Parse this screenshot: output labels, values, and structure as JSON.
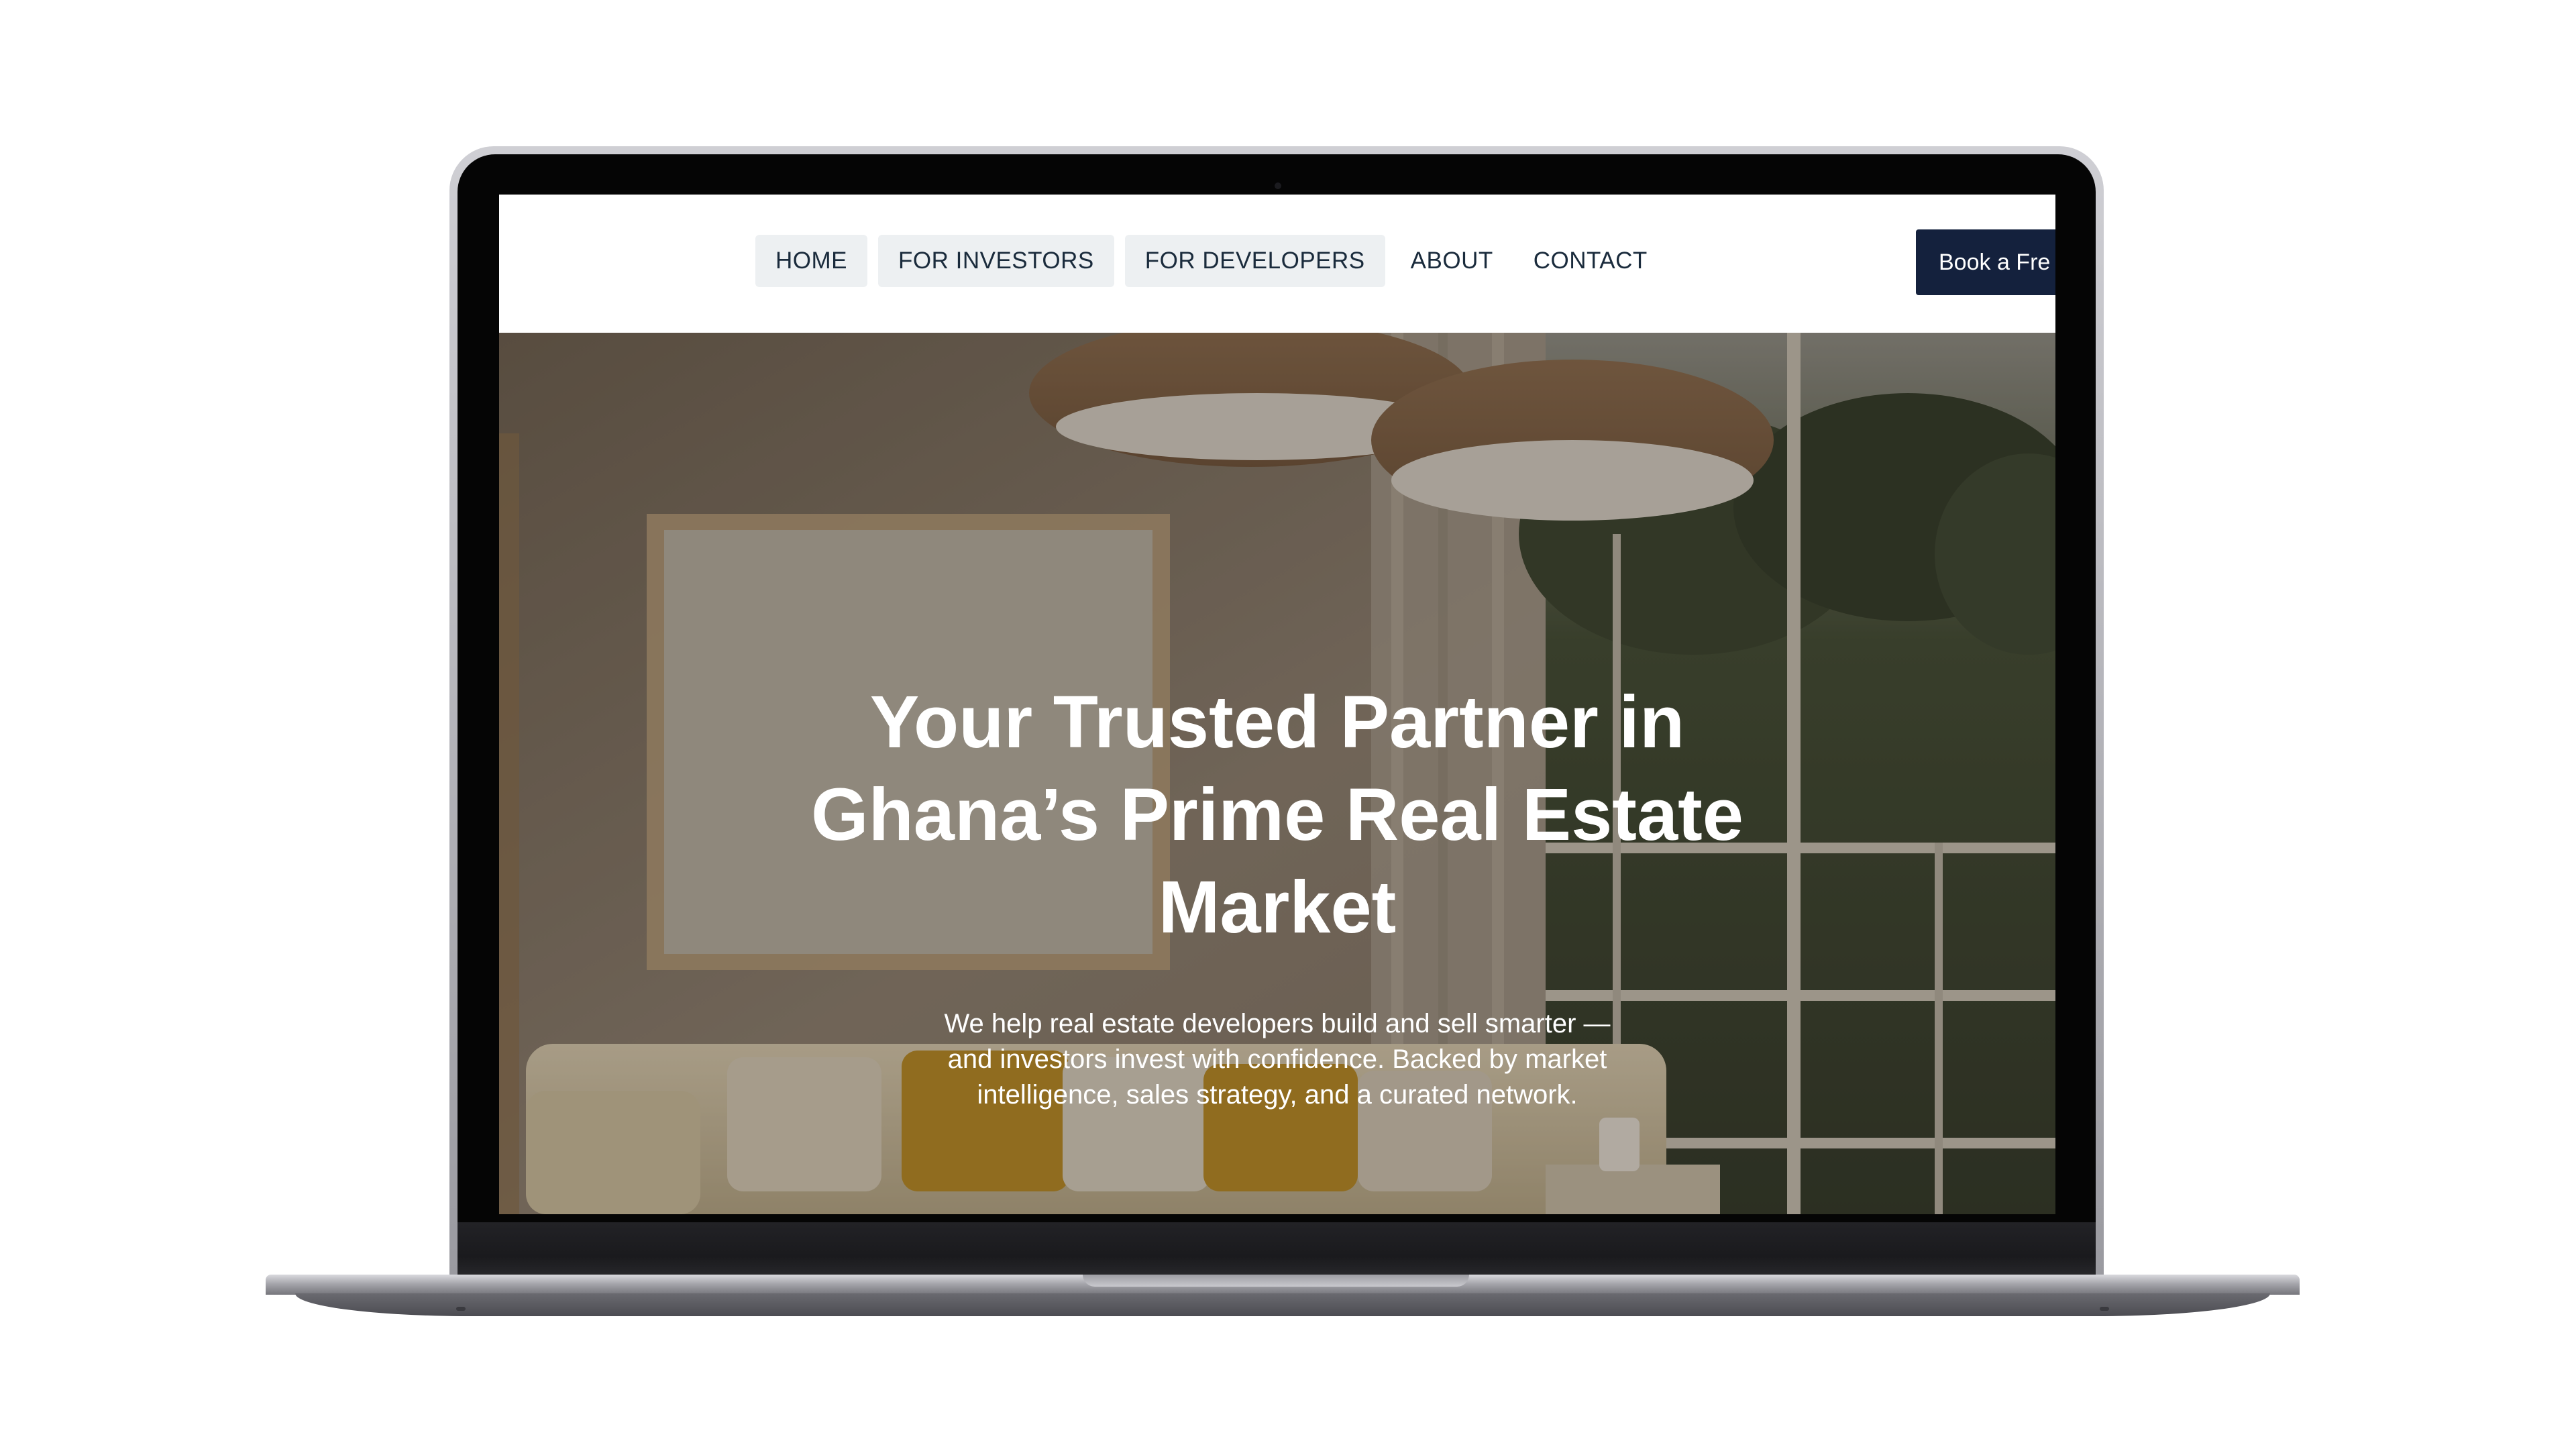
{
  "nav": {
    "items": [
      {
        "label": "HOME"
      },
      {
        "label": "FOR INVESTORS"
      },
      {
        "label": "FOR DEVELOPERS"
      },
      {
        "label": "ABOUT"
      },
      {
        "label": "CONTACT"
      }
    ],
    "cta_label": "Book a Fre"
  },
  "hero": {
    "title_lines": [
      "Your Trusted Partner in",
      "Ghana’s Prime Real Estate",
      "Market"
    ],
    "subtitle_lines": [
      "We help real estate developers build and sell smarter —",
      "and investors invest with confidence. Backed by market",
      "intelligence, sales strategy, and a curated network."
    ]
  },
  "colors": {
    "cta_background": "#14213d",
    "nav_text": "#1a2b3c",
    "nav_active_background": "#edf0f2"
  }
}
